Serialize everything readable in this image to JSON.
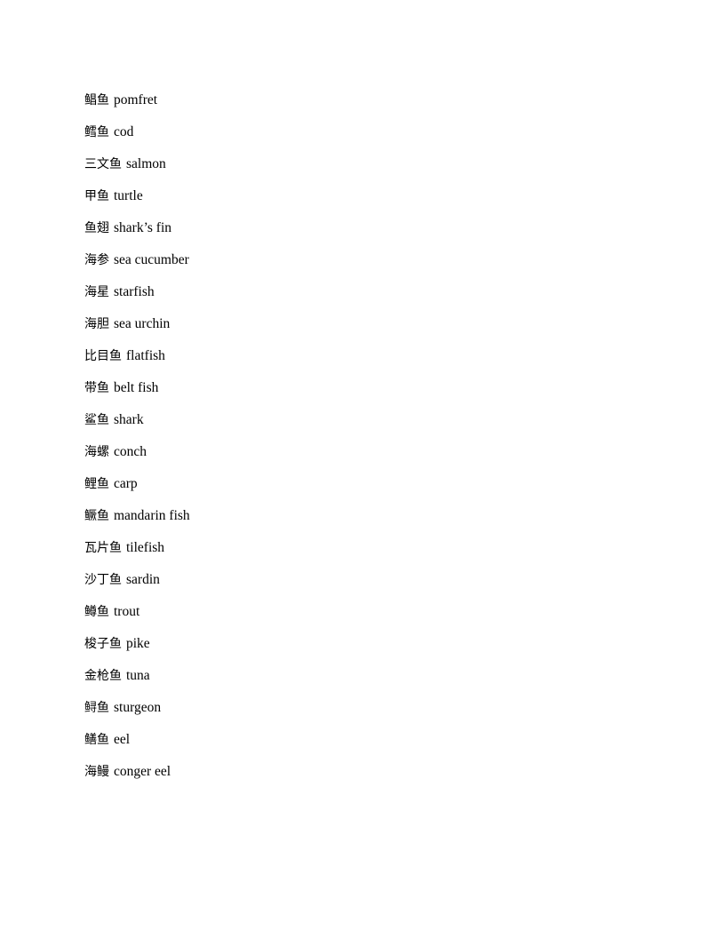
{
  "document": {
    "page_background": "#ffffff",
    "text_color": "#000000",
    "entries": [
      {
        "chinese": "鲳鱼",
        "english": "pomfret"
      },
      {
        "chinese": "鳕鱼",
        "english": "cod"
      },
      {
        "chinese": "三文鱼",
        "english": "salmon"
      },
      {
        "chinese": "甲鱼",
        "english": "turtle"
      },
      {
        "chinese": "鱼翅",
        "english": "shark’s fin"
      },
      {
        "chinese": "海参",
        "english": "sea cucumber"
      },
      {
        "chinese": "海星",
        "english": "starfish"
      },
      {
        "chinese": "海胆",
        "english": "sea urchin"
      },
      {
        "chinese": "比目鱼",
        "english": "flatfish"
      },
      {
        "chinese": "带鱼",
        "english": "belt fish"
      },
      {
        "chinese": "鲨鱼",
        "english": "shark"
      },
      {
        "chinese": "海螺",
        "english": "conch"
      },
      {
        "chinese": "鲤鱼",
        "english": "carp"
      },
      {
        "chinese": "鳜鱼",
        "english": "mandarin fish"
      },
      {
        "chinese": "瓦片鱼",
        "english": "tilefish"
      },
      {
        "chinese": "沙丁鱼",
        "english": "sardin"
      },
      {
        "chinese": "鳟鱼",
        "english": "trout"
      },
      {
        "chinese": "梭子鱼",
        "english": "pike"
      },
      {
        "chinese": "金枪鱼",
        "english": "tuna"
      },
      {
        "chinese": "鲟鱼",
        "english": "sturgeon"
      },
      {
        "chinese": "鳝鱼",
        "english": "eel"
      },
      {
        "chinese": "海鳗",
        "english": "conger eel"
      }
    ]
  }
}
